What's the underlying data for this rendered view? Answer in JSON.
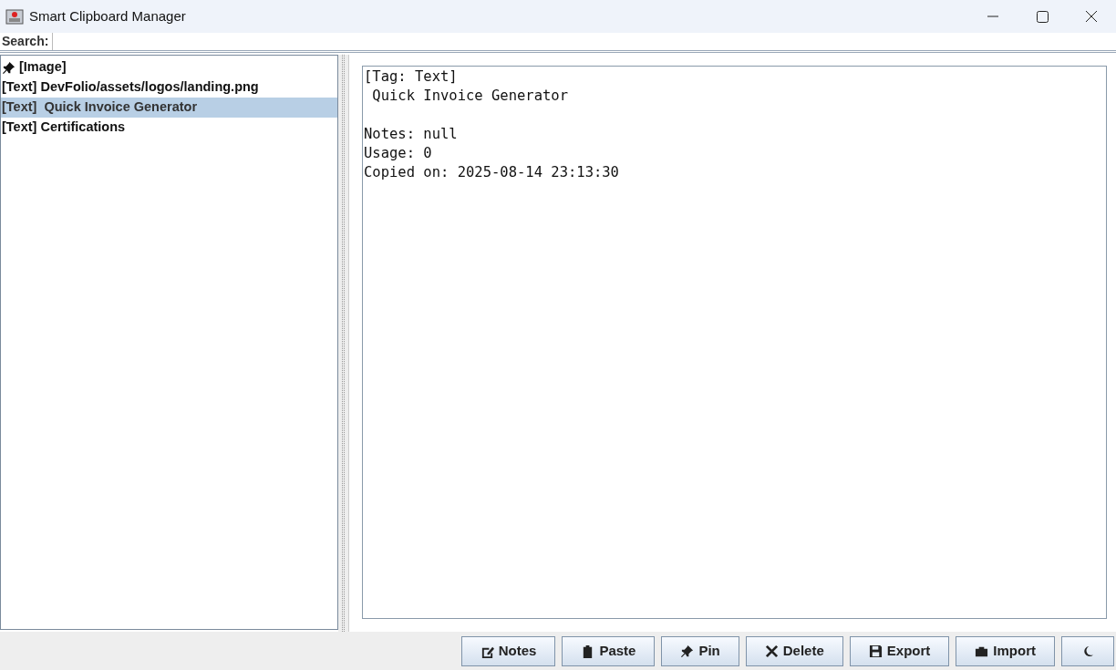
{
  "window": {
    "title": "Smart Clipboard Manager"
  },
  "search": {
    "label": "Search:"
  },
  "clips": [
    {
      "label": "[Image]",
      "pinned": true,
      "selected": false
    },
    {
      "label": "[Text] DevFolio/assets/logos/landing.png",
      "pinned": false,
      "selected": false
    },
    {
      "label": "[Text]  Quick Invoice Generator",
      "pinned": false,
      "selected": true
    },
    {
      "label": "[Text] Certifications",
      "pinned": false,
      "selected": false
    }
  ],
  "detail": {
    "paragraphs": [
      [
        "[Tag: Text]",
        " Quick Invoice Generator"
      ],
      [
        "Notes: null",
        "Usage: 0",
        "Copied on: 2025-08-14 23:13:30"
      ]
    ]
  },
  "buttons": [
    {
      "kind": "notes",
      "label": "Notes"
    },
    {
      "kind": "paste",
      "label": "Paste"
    },
    {
      "kind": "pin",
      "label": "Pin"
    },
    {
      "kind": "delete",
      "label": "Delete"
    },
    {
      "kind": "export",
      "label": "Export"
    },
    {
      "kind": "import",
      "label": "Import"
    },
    {
      "kind": "theme"
    }
  ]
}
